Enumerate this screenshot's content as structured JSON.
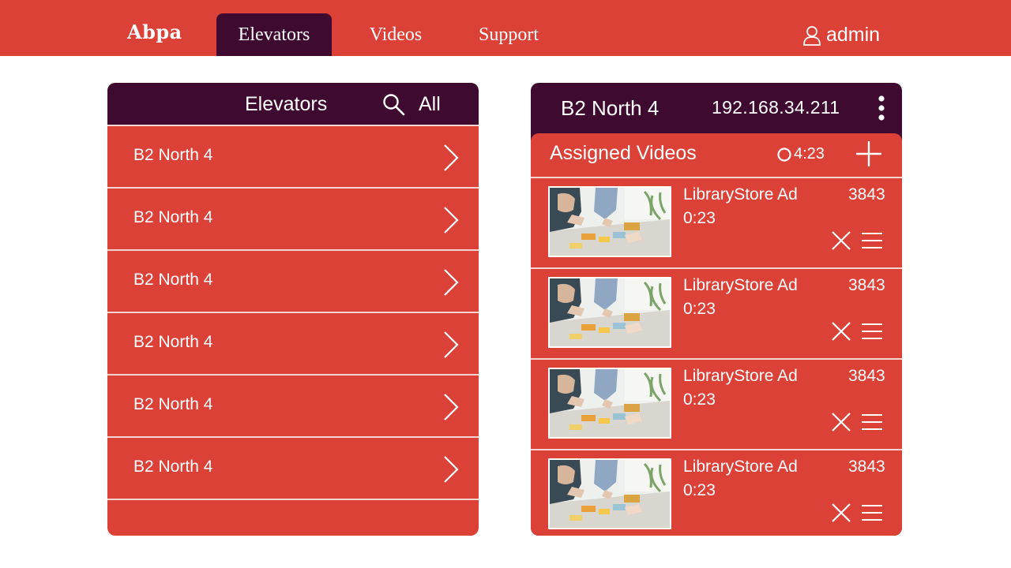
{
  "nav": {
    "brand": "Abpa",
    "tabs": [
      {
        "label": "Elevators",
        "active": true
      },
      {
        "label": "Videos",
        "active": false
      },
      {
        "label": "Support",
        "active": false
      }
    ],
    "user_label": "admin",
    "user_icon": "user-icon"
  },
  "elevators_panel": {
    "title": "Elevators",
    "search_icon": "search-icon",
    "filter_label": "All",
    "items": [
      {
        "label": "B2 North 4"
      },
      {
        "label": "B2 North 4"
      },
      {
        "label": "B2 North 4"
      },
      {
        "label": "B2 North 4"
      },
      {
        "label": "B2 North 4"
      },
      {
        "label": "B2 North 4"
      }
    ]
  },
  "detail_panel": {
    "elevator_name": "B2 North 4",
    "ip": "192.168.34.211",
    "menu_icon": "kebab-menu-icon",
    "assigned": {
      "title": "Assigned Videos",
      "total_duration": "4:23",
      "add_icon": "plus-icon",
      "videos": [
        {
          "title": "LibraryStore Ad",
          "duration": "0:23",
          "count": "3843"
        },
        {
          "title": "LibraryStore Ad",
          "duration": "0:23",
          "count": "3843"
        },
        {
          "title": "LibraryStore Ad",
          "duration": "0:23",
          "count": "3843"
        },
        {
          "title": "LibraryStore Ad",
          "duration": "0:23",
          "count": "3843"
        }
      ]
    }
  },
  "colors": {
    "brand_red": "#dc4138",
    "dark_plum": "#3f0a2f",
    "divider": "#f3d4d1"
  }
}
